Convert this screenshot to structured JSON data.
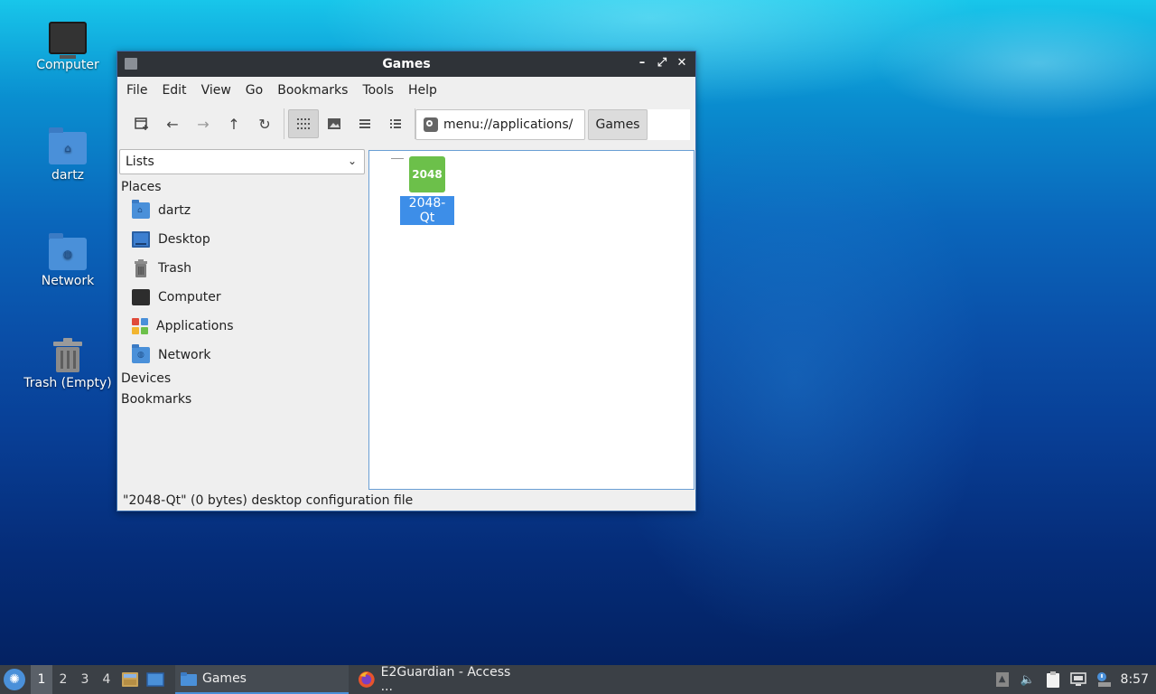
{
  "desktop": {
    "icons": [
      {
        "label": "Computer"
      },
      {
        "label": "dartz"
      },
      {
        "label": "Network"
      },
      {
        "label": "Trash (Empty)"
      }
    ]
  },
  "window": {
    "title": "Games",
    "controls": {
      "minimize": "–",
      "maximize": "⤢",
      "close": "✕"
    },
    "menu": [
      "File",
      "Edit",
      "View",
      "Go",
      "Bookmarks",
      "Tools",
      "Help"
    ],
    "address": "menu://applications/",
    "breadcrumb": "Games",
    "sidebar": {
      "mode": "Lists",
      "places_header": "Places",
      "places": [
        {
          "label": "dartz",
          "icon": "home-folder-icon"
        },
        {
          "label": "Desktop",
          "icon": "desktop-icon"
        },
        {
          "label": "Trash",
          "icon": "trash-icon"
        },
        {
          "label": "Computer",
          "icon": "computer-icon"
        },
        {
          "label": "Applications",
          "icon": "applications-icon"
        },
        {
          "label": "Network",
          "icon": "network-folder-icon"
        }
      ],
      "devices_header": "Devices",
      "bookmarks_header": "Bookmarks"
    },
    "files": [
      {
        "label": "2048-Qt",
        "icon_text": "2048",
        "icon_color": "#6cc04a"
      }
    ],
    "status": "\"2048-Qt\" (0 bytes) desktop configuration file"
  },
  "taskbar": {
    "workspaces": [
      "1",
      "2",
      "3",
      "4"
    ],
    "active_workspace": "1",
    "tasks": [
      {
        "label": "Games"
      },
      {
        "label": "E2Guardian - Access ..."
      }
    ],
    "clock": "8:57"
  },
  "colors": {
    "accent": "#4a90d9",
    "selection": "#3d8ee8",
    "titlebar": "#2f3338",
    "taskbar": "#3b4046"
  }
}
